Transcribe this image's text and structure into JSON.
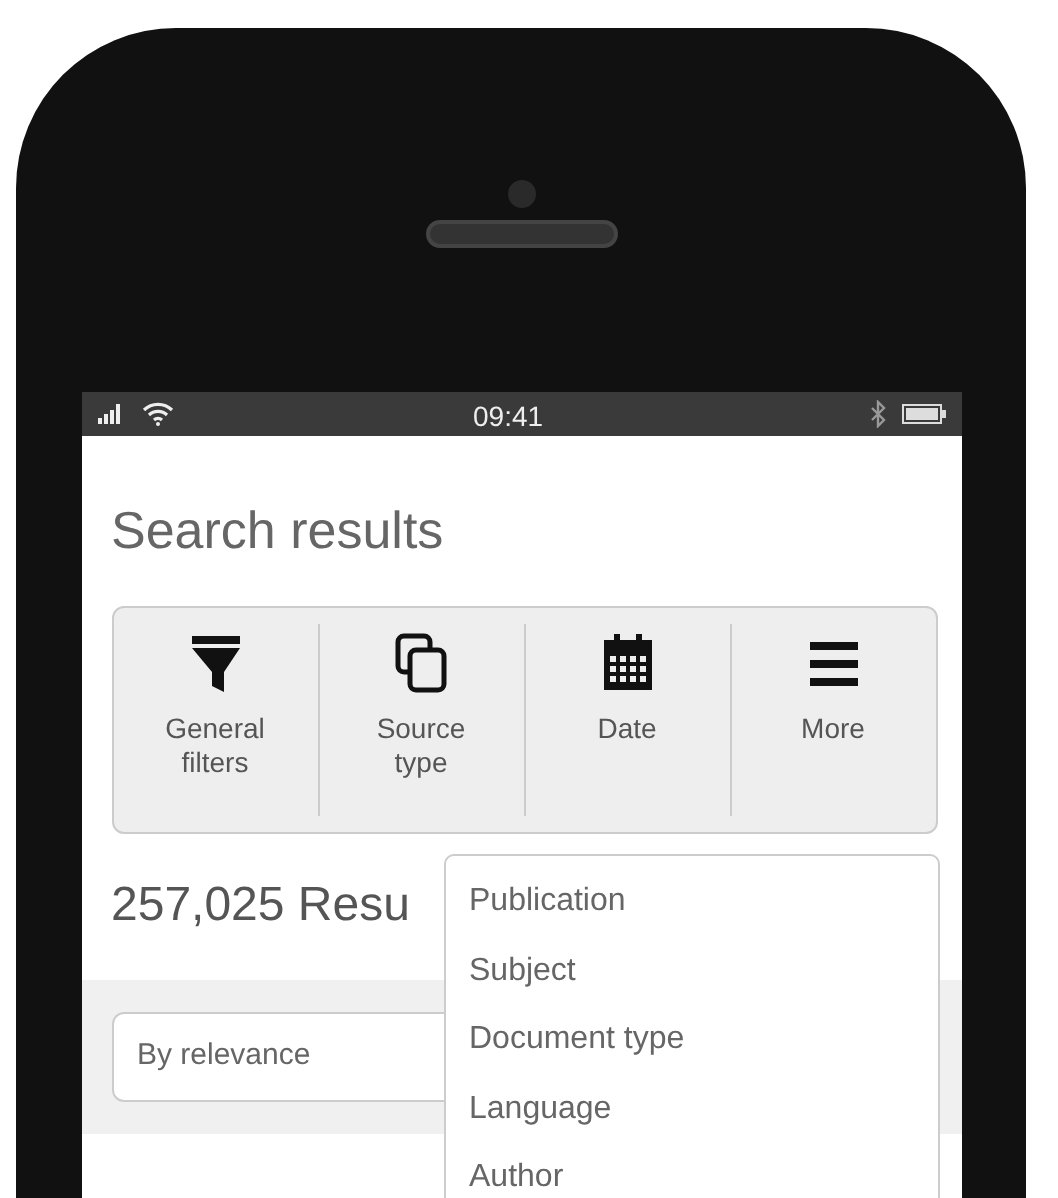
{
  "status_bar": {
    "time": "09:41"
  },
  "title": "Search results",
  "toolbar": [
    {
      "kind": "funnel",
      "label": "General filters"
    },
    {
      "kind": "copy",
      "label": "Source type"
    },
    {
      "kind": "calendar",
      "label": "Date"
    },
    {
      "kind": "menu",
      "label": "More"
    }
  ],
  "results_count": "257,025 Resu",
  "sort_field": {
    "value": "By relevance"
  },
  "dropdown": {
    "items": [
      "Publication",
      "Subject",
      "Document type",
      "Language",
      "Author"
    ]
  }
}
